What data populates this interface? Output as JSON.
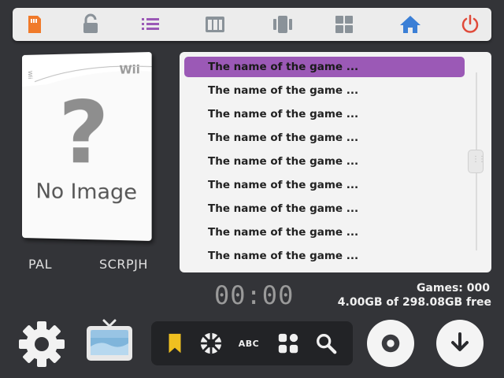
{
  "toolbar": {
    "icons": [
      "sd-card-icon",
      "unlock-icon",
      "list-view-icon",
      "grid-view-icon",
      "carousel-view-icon",
      "tiles-view-icon",
      "home-icon",
      "power-icon"
    ],
    "colors": {
      "sd": "#f07a2a",
      "gray": "#8a9299",
      "purple": "#9b59b6",
      "home": "#3b7fd6",
      "power": "#e04a3a"
    }
  },
  "cover": {
    "brand": "Wii",
    "spine": "Wii",
    "placeholder_text": "No Image",
    "question_mark": "?"
  },
  "game_info": {
    "region": "PAL",
    "id": "SCRPJH"
  },
  "game_list": {
    "items": [
      "The name of the game ...",
      "The name of the game ...",
      "The name of the game ...",
      "The name of the game ...",
      "The name of the game ...",
      "The name of the game ...",
      "The name of the game ...",
      "The name of the game ...",
      "The name of the game ..."
    ],
    "selected_index": 0,
    "selection_color": "#9b59b6"
  },
  "status": {
    "clock": "00:00",
    "games": "Games: 000",
    "free_space": "4.00GB of 298.08GB free"
  },
  "bottom_bar": {
    "abc_label": "ABC",
    "icons": [
      "bookmark-icon",
      "spinner-icon",
      "abc-icon",
      "categories-icon",
      "search-icon"
    ],
    "bookmark_color": "#f0c020"
  }
}
